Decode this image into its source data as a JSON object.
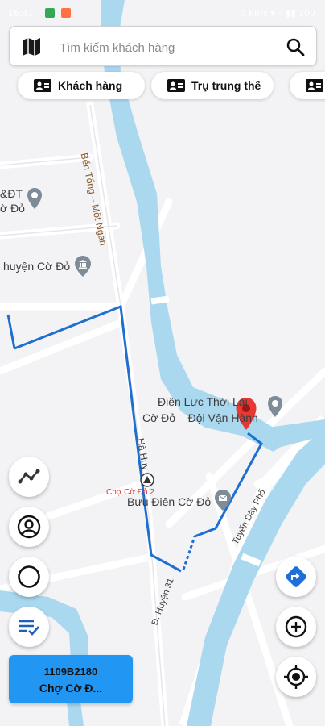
{
  "status_bar": {
    "time": "16:41",
    "right_info": "0 KB/s ▾ ◦ ▮▮ 100"
  },
  "search": {
    "placeholder": "Tìm kiếm khách hàng",
    "map_icon": "map-icon",
    "search_icon": "search-icon"
  },
  "chips": [
    {
      "label": "Khách hàng",
      "icon": "contact-card-icon"
    },
    {
      "label": "Trụ trung thế",
      "icon": "contact-card-icon"
    },
    {
      "label": "",
      "icon": "contact-card-icon"
    }
  ],
  "map": {
    "labels": {
      "dt": "&ĐT",
      "co_do_1": "ờ Đỏ",
      "huyen_co_do": "huyện Cờ Đỏ",
      "ben_tong": "Bến Tổng – Một Ngàn",
      "dien_luc_1": "Điện Lực Thới Lai",
      "dien_luc_2": "Cờ Đỏ – Đội Vận Hành",
      "ha_huy": "Hà Huy",
      "cho_co_do_2": "Chợ Cờ Đỏ 2",
      "buu_dien": "Bưu Điện Cờ Đỏ",
      "tuyen_day_pho": "Tuyến Dãy Phố",
      "d_huyen_31": "Đ. Huyện 31"
    },
    "colors": {
      "water": "#aad8ef",
      "route": "#1f6fd0",
      "pin": "#e53935",
      "background": "#f3f3f5"
    }
  },
  "fab_left": [
    "polyline-icon",
    "user-circle-icon",
    "circle-icon",
    "checklist-icon"
  ],
  "fab_right": [
    "directions-icon",
    "zoom-in-icon",
    "my-location-icon"
  ],
  "info_card": {
    "line1": "1109B2180",
    "line2": "Chợ Cờ Đ..."
  }
}
